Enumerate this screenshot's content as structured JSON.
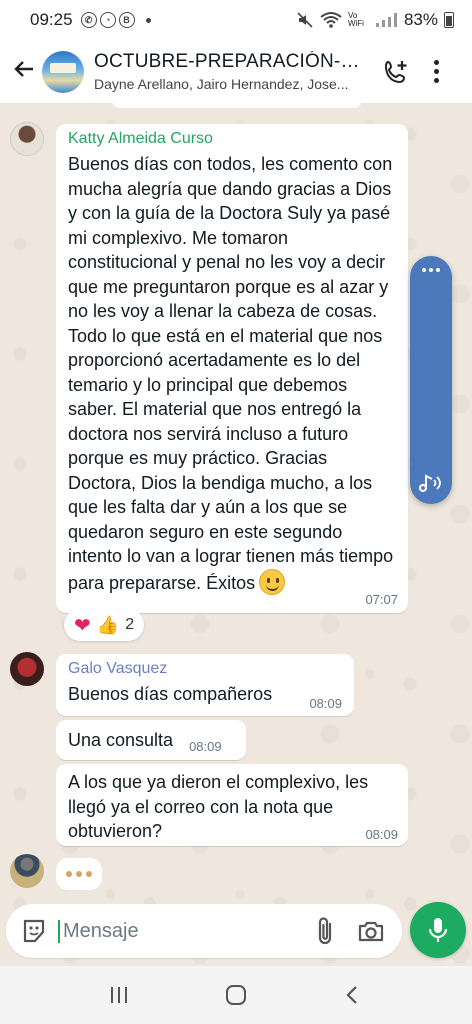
{
  "status_bar": {
    "time": "09:25",
    "battery": "83%",
    "wifi_label": "Vo WiFi",
    "notif_b": "B"
  },
  "header": {
    "title": "OCTUBRE-PREPARACIÓN-C...",
    "members": "Dayne Arellano, Jairo Hernandez, Jose..."
  },
  "messages": [
    {
      "sender": "Katty Almeida Curso",
      "sender_color": "#25a55f",
      "text": "Buenos días con todos, les comento con mucha alegría que dando gracias a Dios y con la guía de la Doctora Suly ya pasé mi complexivo. Me tomaron constitucional y penal no les voy a decir que me preguntaron porque es al azar y no les voy a llenar la cabeza de cosas. Todo lo que está en el material que nos proporcionó acertadamente es lo del temario y lo principal que debemos saber. El material que nos entregó la doctora nos servirá incluso a futuro porque es muy práctico. Gracias Doctora, Dios la bendiga mucho, a los que les falta dar y aún a los que se quedaron seguro en este segundo intento lo van a lograr tienen más tiempo para prepararse. Éxitos",
      "time": "07:07",
      "reactions_count": "2"
    },
    {
      "sender": "Galo Vasquez",
      "sender_color": "#6b7fc9",
      "text": "Buenos días compañeros",
      "time": "08:09"
    },
    {
      "text": "Una consulta",
      "time": "08:09"
    },
    {
      "text": "A los que ya dieron el complexivo, les llegó ya el correo con la nota que obtuvieron?",
      "time": "08:09"
    }
  ],
  "input": {
    "placeholder": "Mensaje"
  },
  "colors": {
    "accent_green": "#1daa61",
    "float_handle": "#4c78bc",
    "chat_bg": "#efe7dd"
  },
  "icons": [
    "back-arrow-icon",
    "add-call-icon",
    "more-vert-icon",
    "sticker-icon",
    "attach-icon",
    "camera-icon",
    "mic-icon",
    "recents-icon",
    "home-icon",
    "back-icon"
  ]
}
